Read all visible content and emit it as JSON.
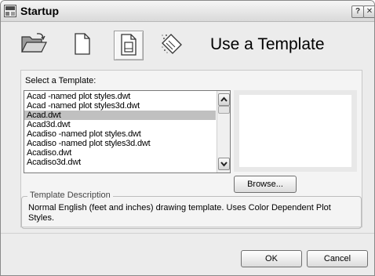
{
  "window": {
    "title": "Startup",
    "help_label": "?",
    "close_label": "✕"
  },
  "modes": {
    "active": "use-a-template",
    "title": "Use a Template",
    "buttons": [
      {
        "icon": "open-folder-icon"
      },
      {
        "icon": "blank-document-icon"
      },
      {
        "icon": "template-document-icon"
      },
      {
        "icon": "wizard-icon"
      }
    ]
  },
  "templates": {
    "label": "Select a Template:",
    "selected_index": 2,
    "items": [
      "Acad -named plot styles.dwt",
      "Acad -named plot styles3d.dwt",
      "Acad.dwt",
      "Acad3d.dwt",
      "Acadiso -named plot styles.dwt",
      "Acadiso -named plot styles3d.dwt",
      "Acadiso.dwt",
      "Acadiso3d.dwt"
    ]
  },
  "browse_label": "Browse...",
  "description": {
    "legend": "Template Description",
    "text": "Normal English (feet and inches) drawing template. Uses Color Dependent Plot Styles."
  },
  "footer": {
    "ok_label": "OK",
    "cancel_label": "Cancel"
  }
}
